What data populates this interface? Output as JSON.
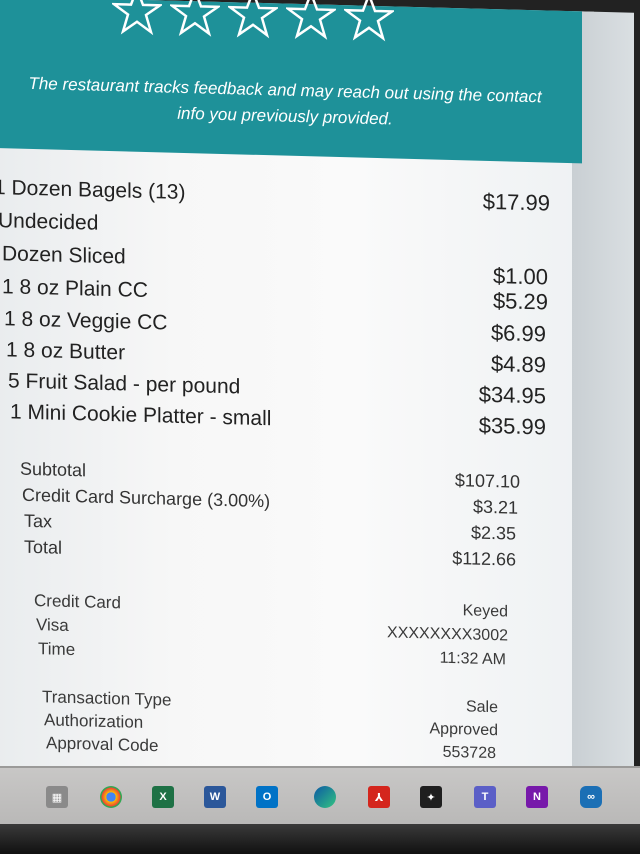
{
  "banner": {
    "feedback_line1": "The restaurant tracks feedback and may reach out using the contact",
    "feedback_line2": "info you previously provided.",
    "stars": 5
  },
  "items": [
    {
      "name": "1 Dozen Bagels (13)",
      "price": "$17.99"
    },
    {
      "name": "Undecided",
      "price": ""
    },
    {
      "name": "Dozen Sliced",
      "price": "$1.00"
    },
    {
      "name": "1 8 oz Plain CC",
      "price": "$5.29"
    },
    {
      "name": "1 8 oz Veggie CC",
      "price": "$6.99"
    },
    {
      "name": "1 8 oz Butter",
      "price": "$4.89"
    },
    {
      "name": "5 Fruit Salad - per pound",
      "price": "$34.95"
    },
    {
      "name": "1 Mini Cookie Platter - small",
      "price": "$35.99"
    }
  ],
  "summary": {
    "subtotal_label": "Subtotal",
    "subtotal_value": "$107.10",
    "surcharge_label": "Credit Card Surcharge (3.00%)",
    "surcharge_value": "$3.21",
    "tax_label": "Tax",
    "tax_value": "$2.35",
    "total_label": "Total",
    "total_value": "$112.66"
  },
  "payment": {
    "method_label": "Credit Card",
    "method_value": "Keyed",
    "card_label": "Visa",
    "card_value": "XXXXXXXX3002",
    "time_label": "Time",
    "time_value": "11:32 AM"
  },
  "transaction": {
    "type_label": "Transaction Type",
    "type_value": "Sale",
    "auth_label": "Authorization",
    "auth_value": "Approved",
    "code_label": "Approval Code",
    "code_value": "553728"
  },
  "taskbar": {
    "icons": [
      "calculator-icon",
      "chrome-icon",
      "excel-icon",
      "word-icon",
      "outlook-icon",
      "edge-icon",
      "acrobat-icon",
      "snip-icon",
      "teams-icon",
      "onenote-icon",
      "app-icon"
    ],
    "colors": {
      "excel": "#1e7145",
      "word": "#2b579a",
      "outlook": "#0072c6",
      "acrobat": "#d4261d",
      "teams": "#5b5fc7",
      "onenote": "#7719aa",
      "banner": "#1e9199"
    }
  }
}
